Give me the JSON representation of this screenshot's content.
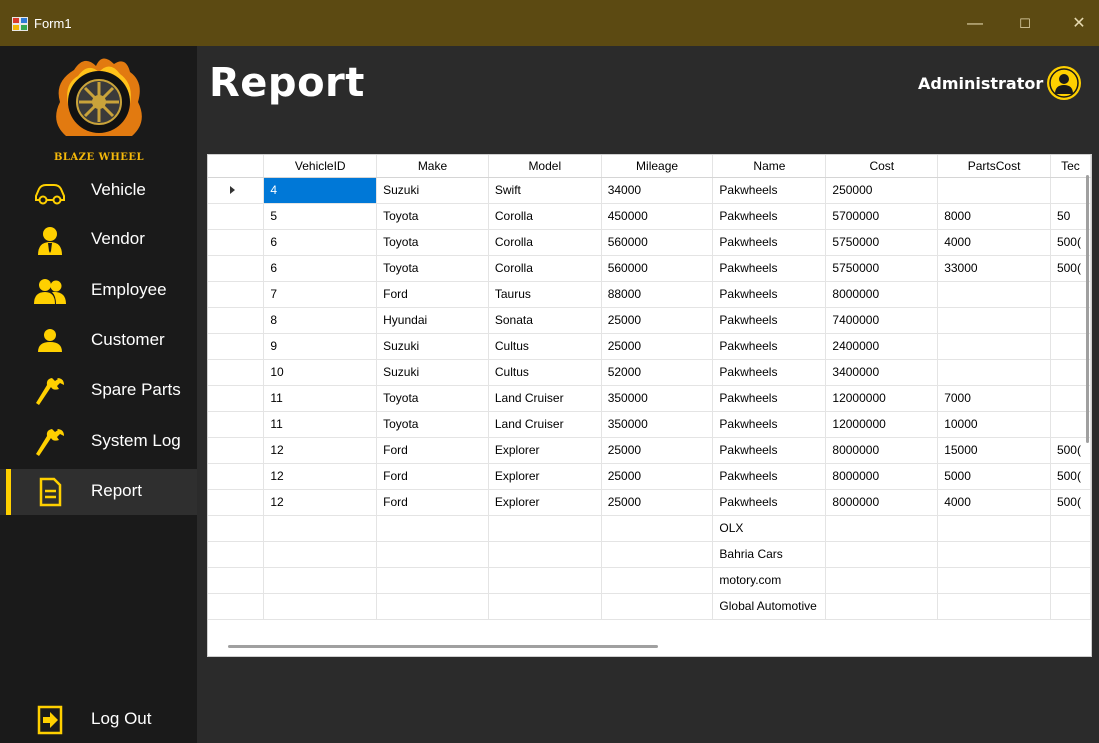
{
  "window": {
    "title": "Form1"
  },
  "titlebar": {
    "minimize": "—",
    "maximize": "☐",
    "close": "✕"
  },
  "brand": {
    "name": "Blaze Wheel"
  },
  "nav": [
    {
      "label": "Vehicle",
      "icon": "car-icon"
    },
    {
      "label": "Vendor",
      "icon": "vendor-icon"
    },
    {
      "label": "Employee",
      "icon": "employee-icon"
    },
    {
      "label": "Customer",
      "icon": "customer-icon"
    },
    {
      "label": "Spare Parts",
      "icon": "wrench-icon"
    },
    {
      "label": "System Log",
      "icon": "wrench-icon"
    },
    {
      "label": "Report",
      "icon": "document-icon",
      "active": true
    }
  ],
  "logout": {
    "label": "Log Out",
    "icon": "logout-icon"
  },
  "header": {
    "title": "Report",
    "user": "Administrator"
  },
  "colors": {
    "accent": "#ffd000",
    "titlebar": "#5c4a12",
    "selection": "#0078d7"
  },
  "grid": {
    "columns": [
      "VehicleID",
      "Make",
      "Model",
      "Mileage",
      "Name",
      "Cost",
      "PartsCost",
      "Tec"
    ],
    "rows": [
      [
        "4",
        "Suzuki",
        "Swift",
        "34000",
        "Pakwheels",
        "250000",
        "",
        ""
      ],
      [
        "5",
        "Toyota",
        "Corolla",
        "450000",
        "Pakwheels",
        "5700000",
        "8000",
        "50"
      ],
      [
        "6",
        "Toyota",
        "Corolla",
        "560000",
        "Pakwheels",
        "5750000",
        "4000",
        "500("
      ],
      [
        "6",
        "Toyota",
        "Corolla",
        "560000",
        "Pakwheels",
        "5750000",
        "33000",
        "500("
      ],
      [
        "7",
        "Ford",
        "Taurus",
        "88000",
        "Pakwheels",
        "8000000",
        "",
        ""
      ],
      [
        "8",
        "Hyundai",
        "Sonata",
        "25000",
        "Pakwheels",
        "7400000",
        "",
        ""
      ],
      [
        "9",
        "Suzuki",
        "Cultus",
        "25000",
        "Pakwheels",
        "2400000",
        "",
        ""
      ],
      [
        "10",
        "Suzuki",
        "Cultus",
        "52000",
        "Pakwheels",
        "3400000",
        "",
        ""
      ],
      [
        "11",
        "Toyota",
        "Land Cruiser",
        "350000",
        "Pakwheels",
        "12000000",
        "7000",
        ""
      ],
      [
        "11",
        "Toyota",
        "Land Cruiser",
        "350000",
        "Pakwheels",
        "12000000",
        "10000",
        ""
      ],
      [
        "12",
        "Ford",
        "Explorer",
        "25000",
        "Pakwheels",
        "8000000",
        "15000",
        "500("
      ],
      [
        "12",
        "Ford",
        "Explorer",
        "25000",
        "Pakwheels",
        "8000000",
        "5000",
        "500("
      ],
      [
        "12",
        "Ford",
        "Explorer",
        "25000",
        "Pakwheels",
        "8000000",
        "4000",
        "500("
      ],
      [
        "",
        "",
        "",
        "",
        "OLX",
        "",
        "",
        ""
      ],
      [
        "",
        "",
        "",
        "",
        "Bahria Cars",
        "",
        "",
        ""
      ],
      [
        "",
        "",
        "",
        "",
        "motory.com",
        "",
        "",
        ""
      ],
      [
        "",
        "",
        "",
        "",
        "Global Automotive",
        "",
        "",
        ""
      ]
    ]
  }
}
